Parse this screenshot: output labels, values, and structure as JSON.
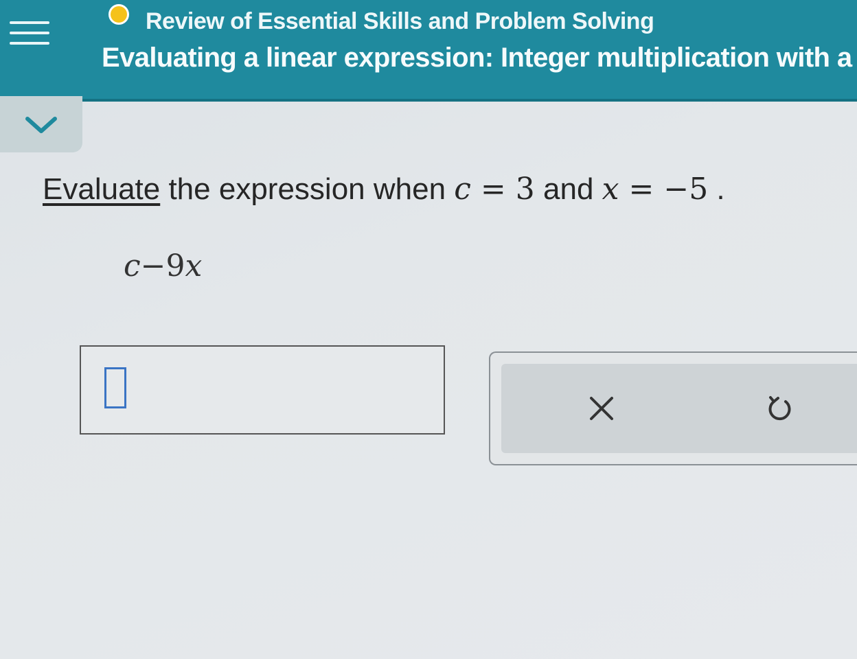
{
  "header": {
    "menu_icon": "hamburger-menu-icon",
    "status_color": "#f5c21b",
    "course_title": "Review of Essential Skills and Problem Solving",
    "topic_title": "Evaluating a linear expression: Integer multiplication with a"
  },
  "collapse": {
    "icon": "chevron-down-icon"
  },
  "question": {
    "link_text": "Evaluate",
    "text_1": " the expression when ",
    "var_c": "c",
    "eq_1": " = ",
    "val_c": "3",
    "and": " and ",
    "var_x": "x",
    "eq_2": " = ",
    "val_x": "−5",
    "period": " ."
  },
  "expression": {
    "c": "c",
    "minus": "−",
    "coef": "9",
    "x": "x"
  },
  "answer": {
    "value": ""
  },
  "tools": {
    "clear_icon": "x-icon",
    "undo_icon": "undo-icon"
  },
  "colors": {
    "header_bg": "#1f8a9e",
    "accent_blue": "#3a74c4"
  }
}
